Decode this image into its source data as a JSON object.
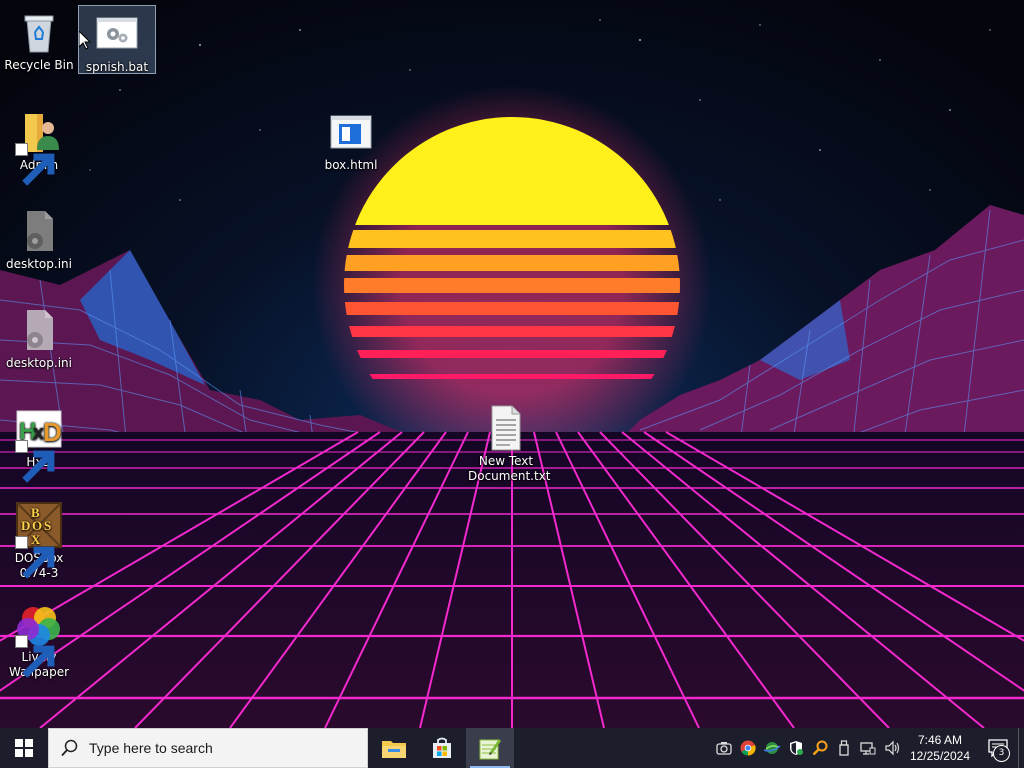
{
  "desktop": {
    "icons": [
      {
        "label": "Recycle Bin",
        "icon": "recycle-bin-icon"
      },
      {
        "label": "spnish.bat",
        "icon": "batch-file-icon",
        "selected": true
      },
      {
        "label": "Admin",
        "icon": "user-folder-icon",
        "shortcut": true
      },
      {
        "label": "box.html",
        "icon": "html-file-icon"
      },
      {
        "label": "desktop.ini",
        "icon": "settings-file-icon"
      },
      {
        "label": "desktop.ini",
        "icon": "settings-file-icon"
      },
      {
        "label": "HxD",
        "icon": "hxd-icon",
        "shortcut": true
      },
      {
        "label": "New Text Document.txt",
        "icon": "text-document-icon"
      },
      {
        "label": "DOSBox 0.74-3",
        "icon": "dosbox-icon",
        "shortcut": true
      },
      {
        "label": "Lively Wallpaper",
        "icon": "lively-wallpaper-icon",
        "shortcut": true
      }
    ],
    "wallpaper": "synthwave-sunset-grid"
  },
  "taskbar": {
    "start_icon": "windows-logo-icon",
    "search_placeholder": "Type here to search",
    "apps": [
      {
        "name": "File Explorer",
        "icon": "file-explorer-icon"
      },
      {
        "name": "Microsoft Store",
        "icon": "store-icon"
      },
      {
        "name": "Notepad++",
        "icon": "notepad-plus-icon",
        "active": true
      }
    ],
    "tray_icons": [
      "camera-icon",
      "chrome-icon",
      "network-globe-icon",
      "security-shield-icon",
      "search-tool-icon",
      "usb-icon",
      "network-icon",
      "volume-icon"
    ],
    "clock": {
      "time": "7:46 AM",
      "date": "12/25/2024"
    },
    "notifications": {
      "count": "3",
      "icon": "notification-icon"
    }
  },
  "colors": {
    "taskbar": "#1c1f2b",
    "grid": "#ff2bd6",
    "sun_top": "#fff11a",
    "sun_bottom": "#ff1a78",
    "mountain": "#6b1a5e",
    "mountain_lines": "#4d8dff"
  }
}
